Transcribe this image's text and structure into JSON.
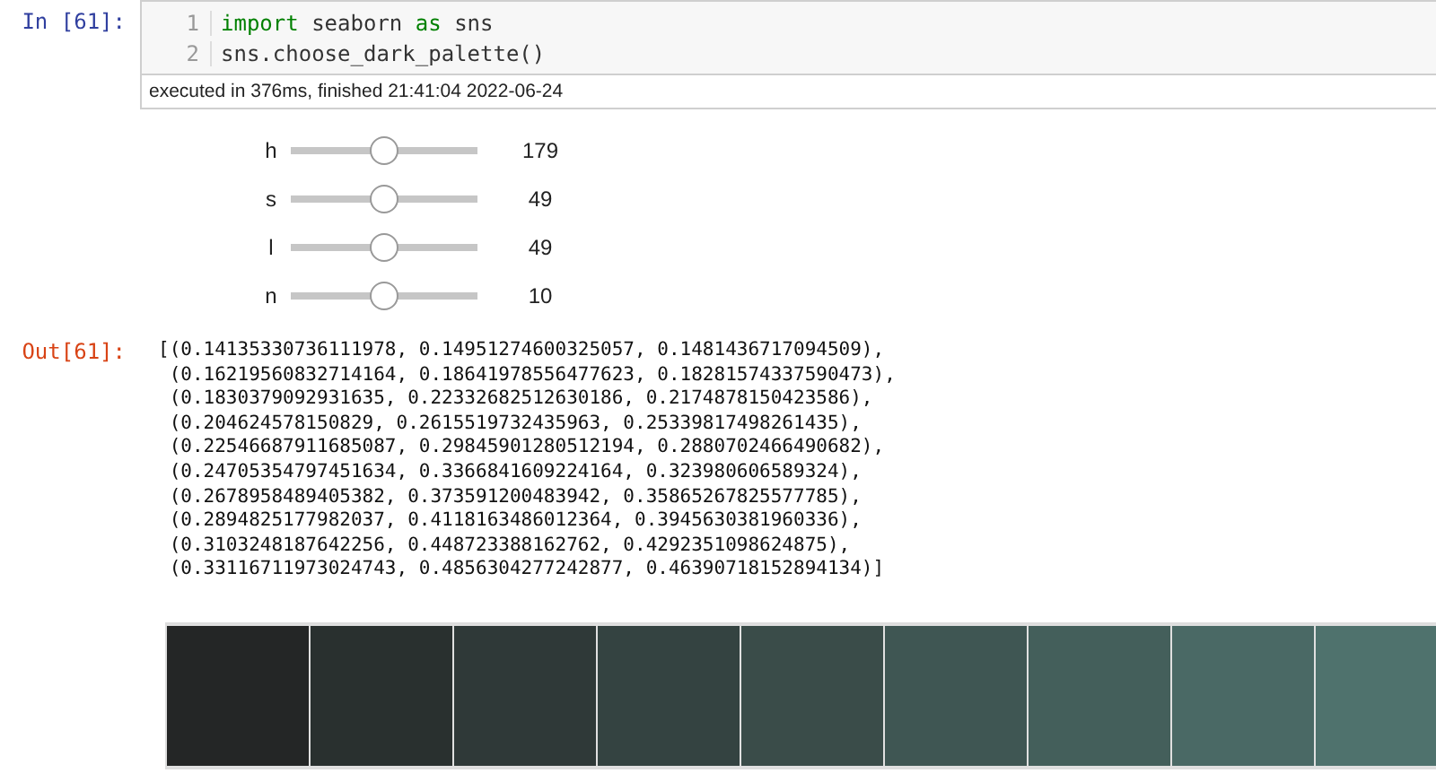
{
  "input_cell": {
    "prompt": "In [61]:",
    "lines": [
      {
        "number": "1",
        "tokens": [
          {
            "text": "import",
            "kind": "keyword"
          },
          {
            "text": " seaborn ",
            "kind": "plain"
          },
          {
            "text": "as",
            "kind": "keyword"
          },
          {
            "text": " sns",
            "kind": "plain"
          }
        ]
      },
      {
        "number": "2",
        "tokens": [
          {
            "text": "sns.choose_dark_palette()",
            "kind": "plain"
          }
        ]
      }
    ],
    "execution_info": "executed in 376ms, finished 21:41:04 2022-06-24"
  },
  "sliders": [
    {
      "label": "h",
      "level": 0.5,
      "reading": "179"
    },
    {
      "label": "s",
      "level": 0.5,
      "reading": "49"
    },
    {
      "label": "l",
      "level": 0.5,
      "reading": "49"
    },
    {
      "label": "n",
      "level": 0.5,
      "reading": "10"
    }
  ],
  "output_cell": {
    "prompt": "Out[61]:",
    "lines": [
      "[(0.14135330736111978, 0.14951274600325057, 0.1481436717094509),",
      " (0.16219560832714164, 0.18641978556477623, 0.18281574337590473),",
      " (0.1830379092931635, 0.22332682512630186, 0.2174878150423586),",
      " (0.204624578150829, 0.2615519732435963, 0.25339817498261435),",
      " (0.22546687911685087, 0.29845901280512194, 0.2880702466490682),",
      " (0.24705354797451634, 0.3366841609224164, 0.323980606589324),",
      " (0.2678958489405382, 0.373591200483942, 0.35865267825577785),",
      " (0.2894825177982037, 0.4118163486012364, 0.3945630381960336),",
      " (0.3103248187642256, 0.448723388162762, 0.4292351098624875),",
      " (0.33116711973024743, 0.4856304277242877, 0.46390718152894134)]"
    ]
  },
  "palette": [
    {
      "color": "#242626"
    },
    {
      "color": "#29302f"
    },
    {
      "color": "#2f3938"
    },
    {
      "color": "#344341"
    },
    {
      "color": "#3a4c49"
    },
    {
      "color": "#3f5653"
    },
    {
      "color": "#445f5b"
    },
    {
      "color": "#4a6965"
    },
    {
      "color": "#4f726d"
    }
  ]
}
